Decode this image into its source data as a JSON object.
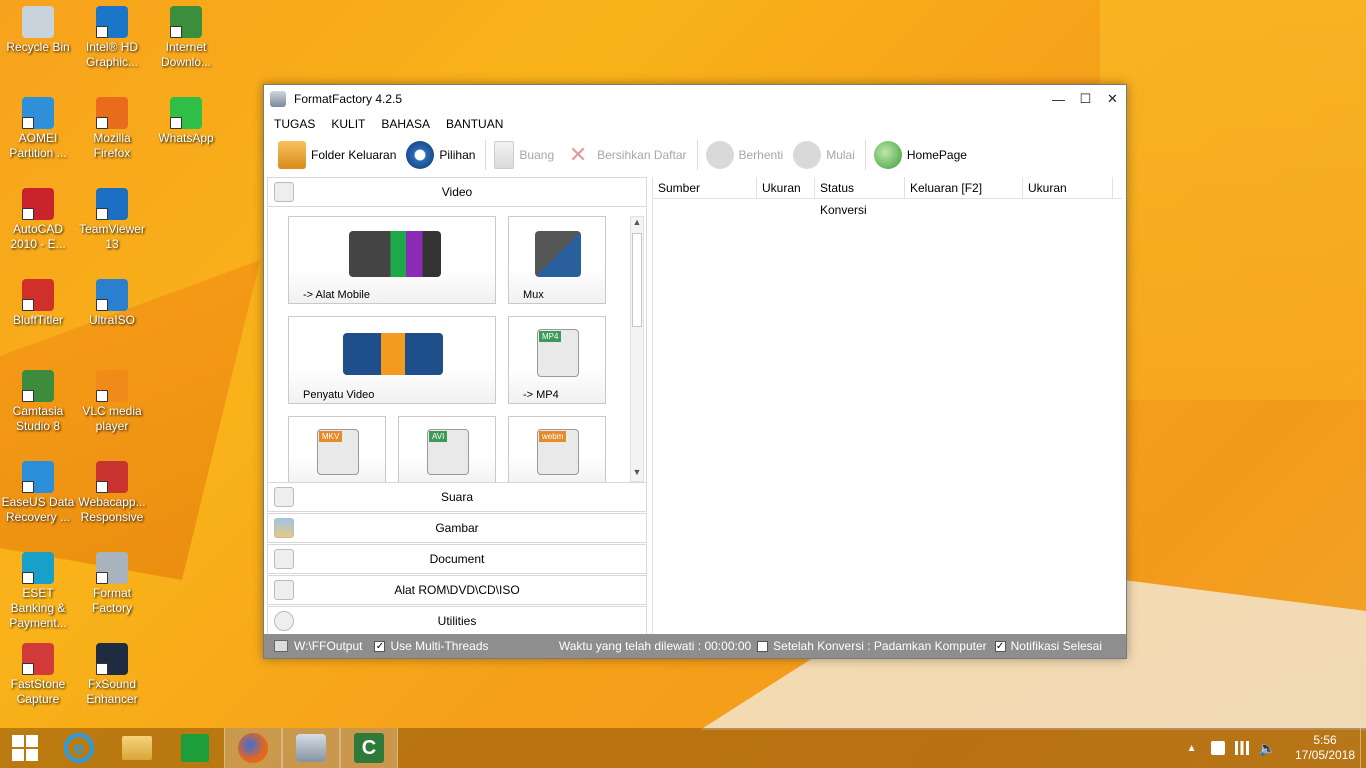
{
  "desktop": {
    "icons": [
      {
        "label": "Recycle Bin",
        "color": "#c9d3dc"
      },
      {
        "label": "Intel® HD Graphic...",
        "color": "#1976c8"
      },
      {
        "label": "Internet Downlo...",
        "color": "#3b8e3b"
      },
      {
        "label": "AOMEI Partition ...",
        "color": "#2f8fd8"
      },
      {
        "label": "Mozilla Firefox",
        "color": "#e96b1c"
      },
      {
        "label": "WhatsApp",
        "color": "#2fbf46"
      },
      {
        "label": "AutoCAD 2010 - E...",
        "color": "#c9232b"
      },
      {
        "label": "TeamViewer 13",
        "color": "#1b6fc2"
      },
      {
        "label": "BluffTitler",
        "color": "#d0302a"
      },
      {
        "label": "UltraISO",
        "color": "#2a7fcf"
      },
      {
        "label": "Camtasia Studio 8",
        "color": "#3d8c3d"
      },
      {
        "label": "VLC media player",
        "color": "#f08a18"
      },
      {
        "label": "EaseUS Data Recovery ...",
        "color": "#2b8ed9"
      },
      {
        "label": "Webacapp... Responsive",
        "color": "#c8322f"
      },
      {
        "label": "ESET Banking & Payment...",
        "color": "#19a0c8"
      },
      {
        "label": "Format Factory",
        "color": "#a9b3bd"
      },
      {
        "label": "FastStone Capture",
        "color": "#d23a3a"
      },
      {
        "label": "FxSound Enhancer",
        "color": "#1f2b40"
      }
    ]
  },
  "window": {
    "title": "FormatFactory 4.2.5",
    "menu": [
      "TUGAS",
      "KULIT",
      "BAHASA",
      "BANTUAN"
    ],
    "toolbar": {
      "folder": "Folder Keluaran",
      "options": "Pilihan",
      "remove": "Buang",
      "clear": "Bersihkan Daftar",
      "stop": "Berhenti",
      "start": "Mulai",
      "homepage": "HomePage"
    },
    "categories": {
      "video": "Video",
      "audio": "Suara",
      "picture": "Gambar",
      "document": "Document",
      "rom": "Alat ROM\\DVD\\CD\\ISO",
      "utilities": "Utilities"
    },
    "tiles": {
      "mobile": "-> Alat Mobile",
      "mux": "Mux",
      "joiner": "Penyatu Video",
      "mp4": "-> MP4",
      "mp4_badge": "MP4",
      "mkv_badge": "MKV",
      "avi_badge": "AVI",
      "webm_badge": "webm"
    },
    "columns": [
      "Sumber",
      "Ukuran",
      "Status Konversi",
      "Keluaran [F2]",
      "Ukuran"
    ],
    "status": {
      "path": "W:\\FFOutput",
      "multithreads": "Use Multi-Threads",
      "elapsed": "Waktu yang telah dilewati : 00:00:00",
      "after": "Setelah Konversi : Padamkan Komputer",
      "notify": "Notifikasi Selesai"
    }
  },
  "taskbar": {
    "time": "5:56",
    "date": "17/05/2018"
  }
}
